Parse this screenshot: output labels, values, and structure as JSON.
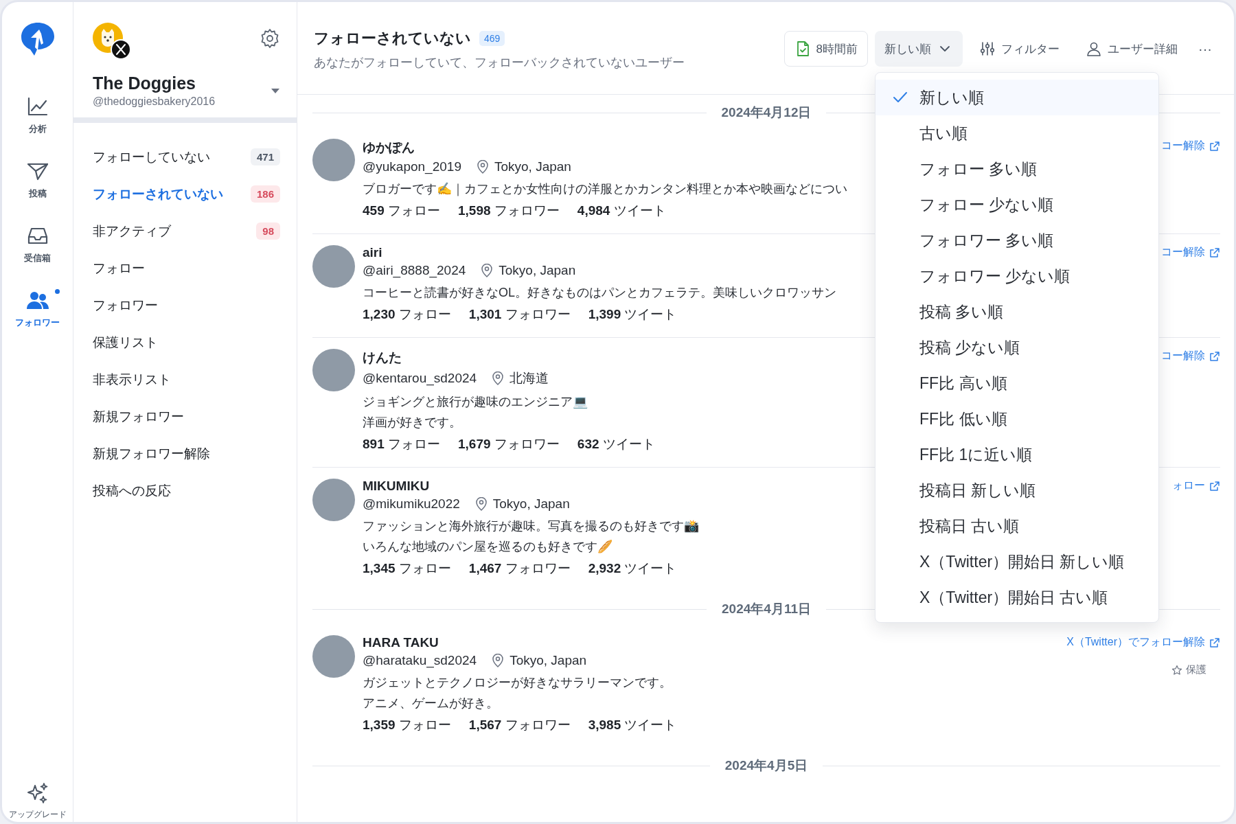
{
  "rail": {
    "items": [
      {
        "kind": "chart",
        "label": "分析",
        "selected": false,
        "dot": false
      },
      {
        "kind": "send",
        "label": "投稿",
        "selected": false,
        "dot": false
      },
      {
        "kind": "inbox",
        "label": "受信箱",
        "selected": false,
        "dot": false
      },
      {
        "kind": "users",
        "label": "フォロワー",
        "selected": true,
        "dot": true
      }
    ],
    "upgrade": {
      "label": "アップグレード"
    }
  },
  "account": {
    "name": "The Doggies",
    "handle": "@thedoggiesbakery2016"
  },
  "sidebar": {
    "items": [
      {
        "label": "フォローしていない",
        "count": "471",
        "alert": false,
        "selected": false
      },
      {
        "label": "フォローされていない",
        "count": "186",
        "alert": true,
        "selected": true
      },
      {
        "label": "非アクティブ",
        "count": "98",
        "alert": true,
        "selected": false
      },
      {
        "label": "フォロー",
        "selected": false
      },
      {
        "label": "フォロワー",
        "selected": false
      },
      {
        "label": "保護リスト",
        "selected": false
      },
      {
        "label": "非表示リスト",
        "selected": false
      },
      {
        "label": "新規フォロワー",
        "selected": false
      },
      {
        "label": "新規フォロワー解除",
        "selected": false
      },
      {
        "label": "投稿への反応",
        "selected": false
      }
    ]
  },
  "header": {
    "title": "フォローされていない",
    "count": "469",
    "subtitle": "あなたがフォローしていて、フォローバックされていないユーザー",
    "sync": "8時間前",
    "sort": {
      "label": "新しい順",
      "open": true
    },
    "filter": "フィルター",
    "details": "ユーザー詳細",
    "more": "···"
  },
  "sort_menu": [
    {
      "label": "新しい順",
      "selected": true
    },
    {
      "label": "古い順",
      "selected": false
    },
    {
      "label": "フォロー 多い順",
      "selected": false
    },
    {
      "label": "フォロー 少ない順",
      "selected": false
    },
    {
      "label": "フォロワー 多い順",
      "selected": false
    },
    {
      "label": "フォロワー 少ない順",
      "selected": false
    },
    {
      "label": "投稿 多い順",
      "selected": false
    },
    {
      "label": "投稿 少ない順",
      "selected": false
    },
    {
      "label": "FF比 高い順",
      "selected": false
    },
    {
      "label": "FF比 低い順",
      "selected": false
    },
    {
      "label": "FF比 1に近い順",
      "selected": false
    },
    {
      "label": "投稿日 新しい順",
      "selected": false
    },
    {
      "label": "投稿日 古い順",
      "selected": false
    },
    {
      "label": "X（Twitter）開始日 新しい順",
      "selected": false
    },
    {
      "label": "X（Twitter）開始日 古い順",
      "selected": false
    }
  ],
  "groups": [
    {
      "date": "2024年4月12日",
      "users": [
        {
          "name": "ゆかぽん",
          "handle": "@yukapon_2019",
          "location": "Tokyo, Japan",
          "bio": [
            "ブロガーです✍️｜カフェとか女性向けの洋服とかカンタン料理とか本や映画などについ"
          ],
          "stats": [
            "**459** フォロー",
            "**1,598** フォロワー",
            "**4,984** ツイート"
          ],
          "action": "コー解除"
        },
        {
          "name": "airi",
          "handle": "@airi_8888_2024",
          "location": "Tokyo, Japan",
          "bio": [
            " コーヒーと読書が好きなOL。好きなものはパンとカフェラテ。美味しいクロワッサン"
          ],
          "stats": [
            "**1,230** フォロー",
            "**1,301** フォロワー",
            "**1,399** ツイート"
          ],
          "action": "コー解除"
        },
        {
          "name": "けんた",
          "handle": "@kentarou_sd2024",
          "location": "北海道",
          "bio": [
            "ジョギングと旅行が趣味のエンジニア💻",
            "洋画が好きです。"
          ],
          "stats": [
            "**891** フォロー",
            "**1,679** フォロワー",
            "**632** ツイート"
          ],
          "action": "コー解除"
        },
        {
          "name": "MIKUMIKU",
          "handle": "@mikumiku2022",
          "location": "Tokyo, Japan",
          "bio": [
            "ファッションと海外旅行が趣味。写真を撮るのも好きです📸",
            "いろんな地域のパン屋を巡るのも好きです🥖"
          ],
          "stats": [
            "**1,345** フォロー",
            "**1,467** フォロワー",
            "**2,932** ツイート"
          ],
          "action": "ォロー"
        }
      ]
    },
    {
      "date": "2024年4月11日",
      "users": [
        {
          "name": "HARA TAKU",
          "handle": "@harataku_sd2024",
          "location": "Tokyo, Japan",
          "bio": [
            "ガジェットとテクノロジーが好きなサラリーマンです。",
            "アニメ、ゲームが好き。"
          ],
          "stats": [
            "**1,359** フォロー",
            "**1,567** フォロワー",
            "**3,985** ツイート"
          ],
          "action": "X（Twitter）でフォロー解除",
          "protect": "保護"
        }
      ]
    },
    {
      "date": "2024年4月5日"
    }
  ]
}
